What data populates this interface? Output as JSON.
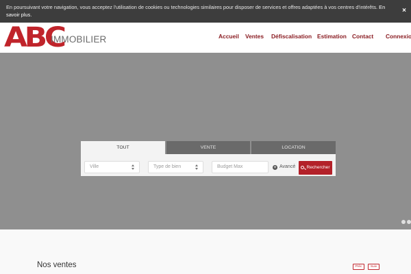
{
  "cookie_banner": {
    "message": "En poursuivant votre navigation, vous acceptez l'utilisation de cookies ou technologies similaires pour disposer de services et offres adaptées à vos centres d'intérêts.",
    "link_label": "En savoir plus.",
    "close_label": "×"
  },
  "header": {
    "logo_letters": "ABC",
    "logo_word": "IMMOBILIER",
    "nav": [
      "Accueil",
      "Ventes",
      "Défiscalisation",
      "Estimation",
      "Contact",
      "Connexion"
    ]
  },
  "search": {
    "tabs": [
      "TOUT",
      "VENTE",
      "LOCATION"
    ],
    "active_tab": "TOUT",
    "city_placeholder": "Ville",
    "type_placeholder": "Type de bien",
    "budget_placeholder": "Budget Max",
    "advanced_label": "Avancé",
    "submit_label": "Rechercher"
  },
  "slider": {
    "dots": 2
  },
  "sales": {
    "title": "Nos ventes",
    "prev_label": "Préc",
    "next_label": "Suiv"
  },
  "colors": {
    "brand_red": "#c0242b",
    "nav_red": "#8a1c22",
    "hero_gray": "#8f8f8f",
    "cookie_bg": "#3d3d3d"
  }
}
